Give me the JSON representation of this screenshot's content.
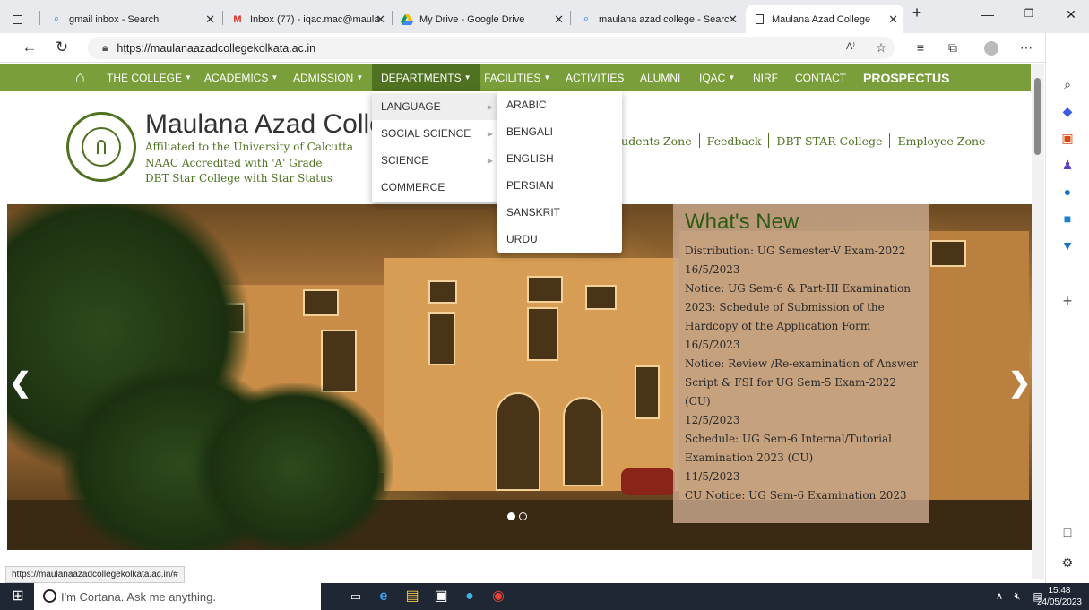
{
  "browser": {
    "tabs": [
      {
        "title": "gmail inbox - Search",
        "icon": "search-icon"
      },
      {
        "title": "Inbox (77) - iqac.mac@maula",
        "icon": "gmail-icon"
      },
      {
        "title": "My Drive - Google Drive",
        "icon": "google-drive-icon"
      },
      {
        "title": "maulana azad college - Searc",
        "icon": "search-icon"
      },
      {
        "title": "Maulana Azad College",
        "icon": "page-icon",
        "active": true
      }
    ],
    "url": "https://maulanaazadcollegekolkata.ac.in",
    "status_url": "https://maulanaazadcollegekolkata.ac.in/#"
  },
  "nav": {
    "items": [
      {
        "label": "THE COLLEGE",
        "caret": true
      },
      {
        "label": "ACADEMICS",
        "caret": true
      },
      {
        "label": "ADMISSION",
        "caret": true
      },
      {
        "label": "DEPARTMENTS",
        "caret": true,
        "selected": true
      },
      {
        "label": "FACILITIES",
        "caret": true
      },
      {
        "label": "ACTIVITIES"
      },
      {
        "label": "ALUMNI"
      },
      {
        "label": "IQAC",
        "caret": true
      },
      {
        "label": "NIRF"
      },
      {
        "label": "CONTACT"
      },
      {
        "label": "PROSPECTUS",
        "bold": true
      }
    ],
    "departments_menu": [
      "LANGUAGE",
      "SOCIAL SCIENCE",
      "SCIENCE",
      "COMMERCE"
    ],
    "language_submenu": [
      "ARABIC",
      "BENGALI",
      "ENGLISH",
      "PERSIAN",
      "SANSKRIT",
      "URDU"
    ]
  },
  "header": {
    "college_name": "Maulana Azad Colle",
    "affiliation": "Affiliated to the University of Calcutta",
    "naac": "NAAC Accredited with 'A' Grade",
    "dbt": "DBT Star College with Star Status",
    "links": [
      "tudents Zone",
      "Feedback",
      "DBT STAR College",
      "Employee Zone"
    ]
  },
  "whats_new": {
    "title": "What's New",
    "items": [
      "Distribution: UG Semester-V Exam-2022",
      "16/5/2023",
      "Notice: UG Sem-6 & Part-III Examination",
      "2023: Schedule of Submission of the",
      "Hardcopy of the Application Form",
      "16/5/2023",
      "Notice: Review /Re-examination of Answer",
      "Script & FSI for UG Sem-5 Exam-2022 (CU)",
      "12/5/2023",
      "Schedule: UG Sem-6 Internal/Tutorial",
      "Examination 2023 (CU)",
      "11/5/2023",
      "CU Notice: UG Sem-6 Examination 2023"
    ]
  },
  "slider": {
    "slide_count": 2,
    "active_slide": 1
  },
  "taskbar": {
    "cortana_placeholder": "I'm Cortana. Ask me anything.",
    "time": "15:48",
    "date": "24/05/2023"
  },
  "colors": {
    "nav_green": "#7a9e3a",
    "nav_selected": "#4e7220",
    "heading_green": "#2f5a12"
  }
}
